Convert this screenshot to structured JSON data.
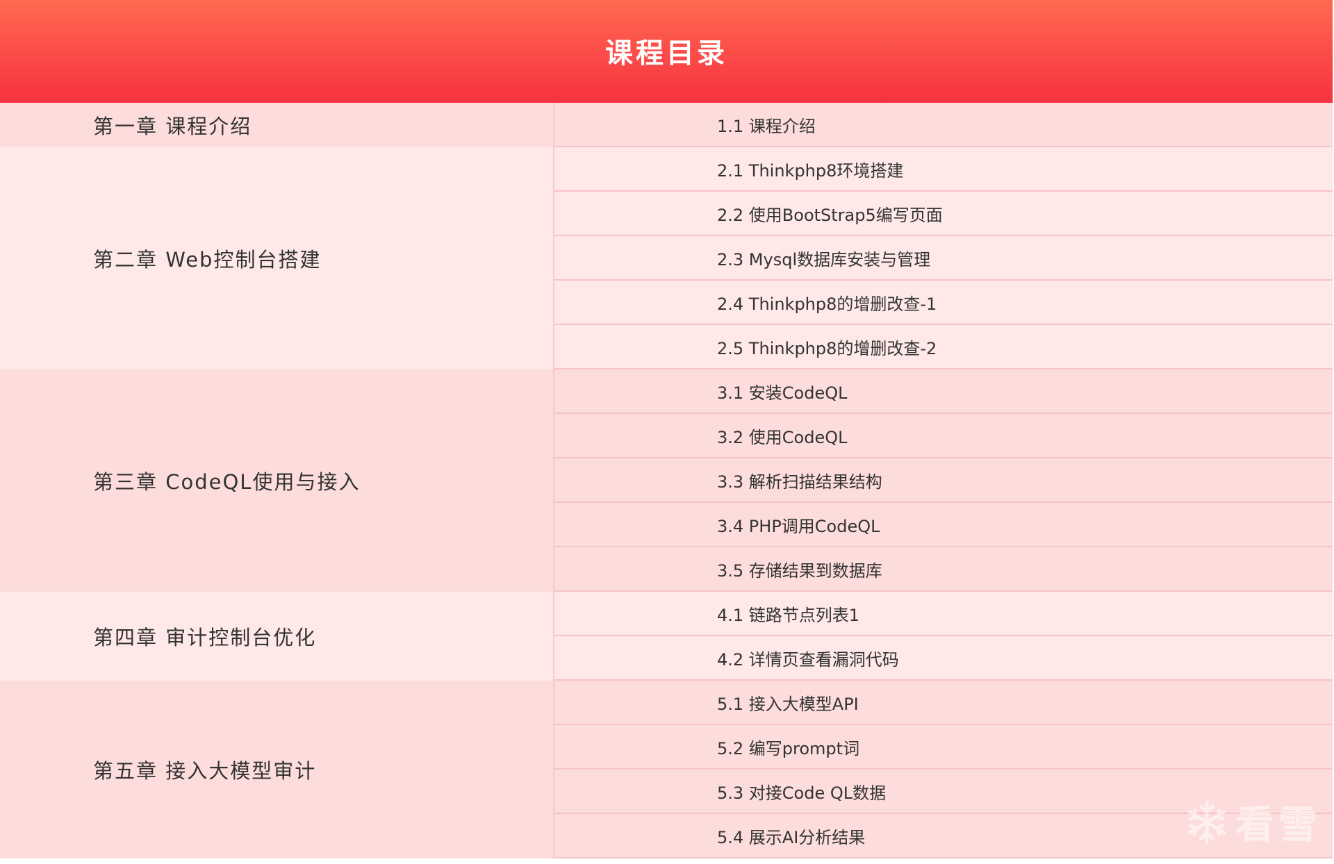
{
  "header": {
    "title": "课程目录"
  },
  "chapters": [
    {
      "title": "第一章 课程介绍",
      "sections": [
        "1.1 课程介绍"
      ]
    },
    {
      "title": "第二章 Web控制台搭建",
      "sections": [
        "2.1 Thinkphp8环境搭建",
        "2.2 使用BootStrap5编写页面",
        "2.3 Mysql数据库安装与管理",
        "2.4 Thinkphp8的增删改查-1",
        "2.5 Thinkphp8的增删改查-2"
      ]
    },
    {
      "title": "第三章 CodeQL使用与接入",
      "sections": [
        "3.1 安装CodeQL",
        "3.2 使用CodeQL",
        "3.3 解析扫描结果结构",
        "3.4 PHP调用CodeQL",
        "3.5 存储结果到数据库"
      ]
    },
    {
      "title": "第四章 审计控制台优化",
      "sections": [
        "4.1 链路节点列表1",
        "4.2 详情页查看漏洞代码"
      ]
    },
    {
      "title": "第五章 接入大模型审计",
      "sections": [
        "5.1 接入大模型API",
        "5.2 编写prompt词",
        "5.3 对接Code QL数据",
        "5.4 展示AI分析结果"
      ]
    }
  ],
  "watermark": {
    "text": "看雪",
    "icon": "snowflake-icon"
  }
}
